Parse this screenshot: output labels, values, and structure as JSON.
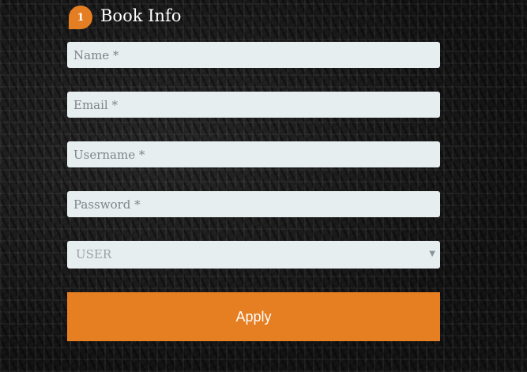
{
  "section": {
    "step_number": "1",
    "title": "Book Info"
  },
  "form": {
    "name": {
      "value": "",
      "placeholder": "Name *"
    },
    "email": {
      "value": "",
      "placeholder": "Email *"
    },
    "username": {
      "value": "",
      "placeholder": "Username *"
    },
    "password": {
      "value": "",
      "placeholder": "Password *"
    },
    "role_select": {
      "selected": "USER",
      "arrow_icon": "triangle-down-icon",
      "arrow_glyph": "▼"
    },
    "apply_label": "Apply"
  },
  "colors": {
    "accent": "#e67e22",
    "field_background": "#e7eef0",
    "page_background": "#161616",
    "title_text": "#ffffff"
  }
}
